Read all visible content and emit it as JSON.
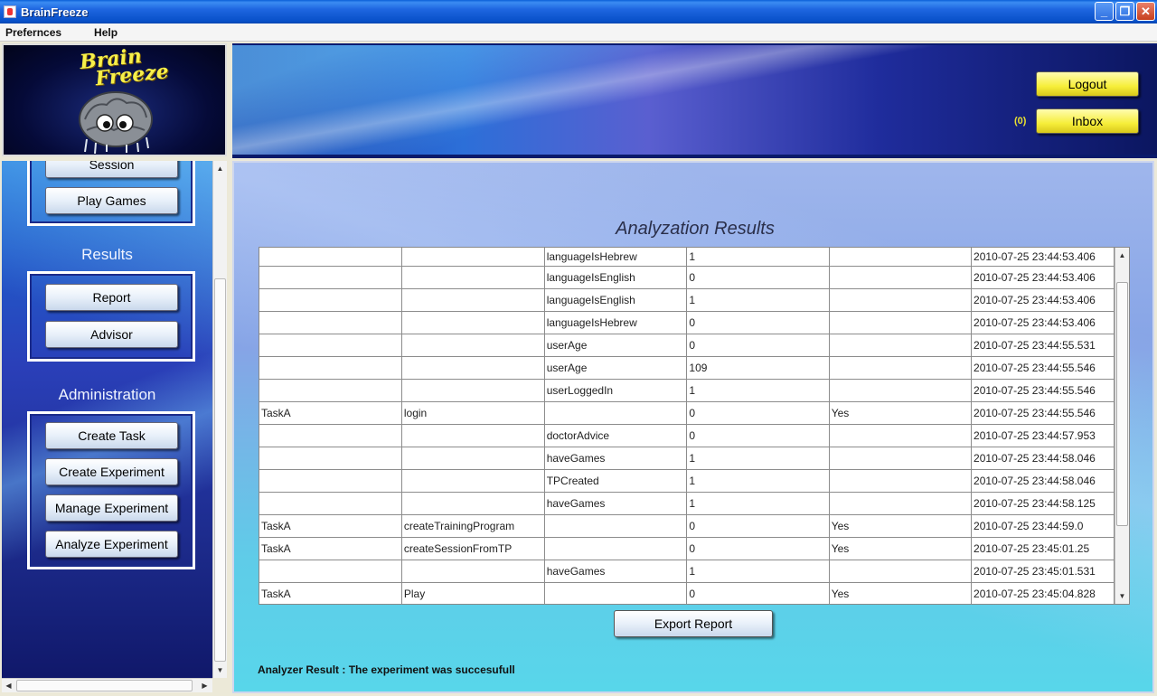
{
  "window": {
    "title": "BrainFreeze",
    "controls": [
      "_",
      "❐",
      "✕"
    ]
  },
  "menu": {
    "items": [
      "Prefernces",
      "Help"
    ]
  },
  "logo": {
    "text": "Brain Freeze"
  },
  "header": {
    "logout_label": "Logout",
    "inbox_label": "Inbox",
    "inbox_count": "(0)"
  },
  "sidebar": {
    "session_label": "Session",
    "play_games_label": "Play Games",
    "results_heading": "Results",
    "report_label": "Report",
    "advisor_label": "Advisor",
    "administration_heading": "Administration",
    "create_task_label": "Create Task",
    "create_experiment_label": "Create Experiment",
    "manage_experiment_label": "Manage Experiment",
    "analyze_experiment_label": "Analyze Experiment"
  },
  "main": {
    "title": "Analyzation Results",
    "rows": [
      [
        "",
        "",
        "languageIsHebrew",
        "1",
        "",
        "2010-07-25 23:44:53.406"
      ],
      [
        "",
        "",
        "languageIsEnglish",
        "0",
        "",
        "2010-07-25 23:44:53.406"
      ],
      [
        "",
        "",
        "languageIsEnglish",
        "1",
        "",
        "2010-07-25 23:44:53.406"
      ],
      [
        "",
        "",
        "languageIsHebrew",
        "0",
        "",
        "2010-07-25 23:44:53.406"
      ],
      [
        "",
        "",
        "userAge",
        "0",
        "",
        "2010-07-25 23:44:55.531"
      ],
      [
        "",
        "",
        "userAge",
        "109",
        "",
        "2010-07-25 23:44:55.546"
      ],
      [
        "",
        "",
        "userLoggedIn",
        "1",
        "",
        "2010-07-25 23:44:55.546"
      ],
      [
        "TaskA",
        "login",
        "",
        "0",
        "Yes",
        "2010-07-25 23:44:55.546"
      ],
      [
        "",
        "",
        "doctorAdvice",
        "0",
        "",
        "2010-07-25 23:44:57.953"
      ],
      [
        "",
        "",
        "haveGames",
        "1",
        "",
        "2010-07-25 23:44:58.046"
      ],
      [
        "",
        "",
        "TPCreated",
        "1",
        "",
        "2010-07-25 23:44:58.046"
      ],
      [
        "",
        "",
        "haveGames",
        "1",
        "",
        "2010-07-25 23:44:58.125"
      ],
      [
        "TaskA",
        "createTrainingProgram",
        "",
        "0",
        "Yes",
        "2010-07-25 23:44:59.0"
      ],
      [
        "TaskA",
        "createSessionFromTP",
        "",
        "0",
        "Yes",
        "2010-07-25 23:45:01.25"
      ],
      [
        "",
        "",
        "haveGames",
        "1",
        "",
        "2010-07-25 23:45:01.531"
      ],
      [
        "TaskA",
        "Play",
        "",
        "0",
        "Yes",
        "2010-07-25 23:45:04.828"
      ]
    ],
    "export_label": "Export Report",
    "result_text": "Analyzer Result : The experiment was succesufull"
  }
}
